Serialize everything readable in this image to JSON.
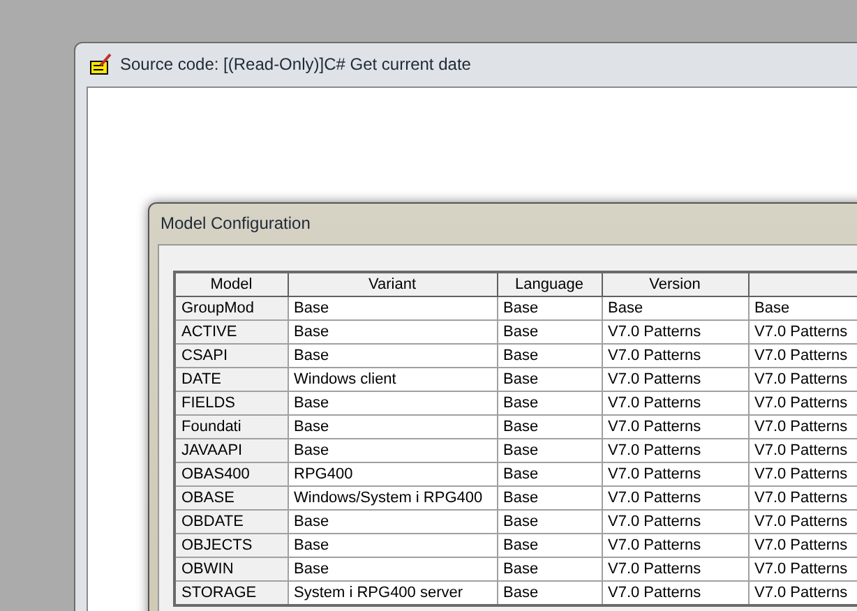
{
  "source_window": {
    "title": "Source code: [(Read-Only)]C# Get current date"
  },
  "dialog": {
    "title": "Model Configuration",
    "table": {
      "columns": [
        "Model",
        "Variant",
        "Language",
        "Version"
      ],
      "rows": [
        [
          "GroupMod",
          "Base",
          "Base",
          "Base",
          "Base"
        ],
        [
          "ACTIVE",
          "Base",
          "Base",
          "V7.0 Patterns",
          "V7.0 Patterns"
        ],
        [
          "CSAPI",
          "Base",
          "Base",
          "V7.0 Patterns",
          "V7.0 Patterns"
        ],
        [
          "DATE",
          "Windows client",
          "Base",
          "V7.0 Patterns",
          "V7.0 Patterns"
        ],
        [
          "FIELDS",
          "Base",
          "Base",
          "V7.0 Patterns",
          "V7.0 Patterns"
        ],
        [
          "Foundati",
          "Base",
          "Base",
          "V7.0 Patterns",
          "V7.0 Patterns"
        ],
        [
          "JAVAAPI",
          "Base",
          "Base",
          "V7.0 Patterns",
          "V7.0 Patterns"
        ],
        [
          "OBAS400",
          "RPG400",
          "Base",
          "V7.0 Patterns",
          "V7.0 Patterns"
        ],
        [
          "OBASE",
          "Windows/System i RPG400",
          "Base",
          "V7.0 Patterns",
          "V7.0 Patterns"
        ],
        [
          "OBDATE",
          "Base",
          "Base",
          "V7.0 Patterns",
          "V7.0 Patterns"
        ],
        [
          "OBJECTS",
          "Base",
          "Base",
          "V7.0 Patterns",
          "V7.0 Patterns"
        ],
        [
          "OBWIN",
          "Base",
          "Base",
          "V7.0 Patterns",
          "V7.0 Patterns"
        ],
        [
          "STORAGE",
          "System i RPG400 server",
          "Base",
          "V7.0 Patterns",
          "V7.0 Patterns"
        ]
      ]
    }
  }
}
